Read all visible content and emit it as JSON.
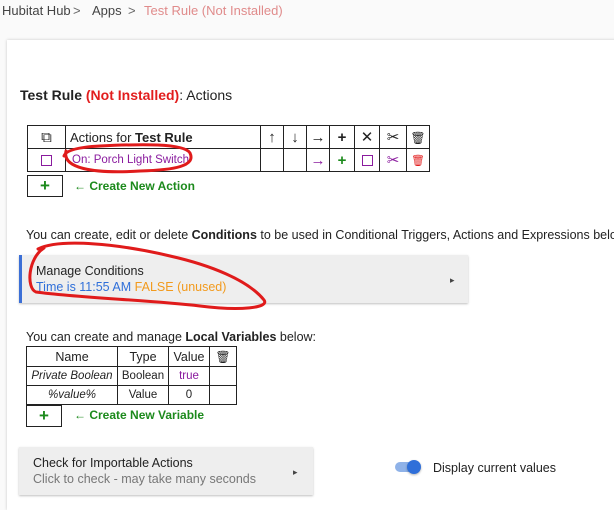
{
  "breadcrumb": {
    "home": "Hubitat Hub",
    "sep": ">",
    "apps": "Apps",
    "current": "Test Rule (Not Installed)"
  },
  "title": {
    "name": "Test Rule",
    "status": "(Not Installed)",
    "suffix": ": Actions"
  },
  "actions_table": {
    "copy_icon": "⧉",
    "header_prefix": "Actions for ",
    "header_rule": "Test Rule",
    "header_icons": [
      "↑",
      "↓",
      "→",
      "+",
      "✕",
      "✂",
      "🗑"
    ],
    "row": {
      "label": "On: Porch Light Switch",
      "arrow": "→",
      "plus": "+",
      "scissors": "✂",
      "trash": "🗑"
    }
  },
  "create_action": {
    "plus": "+",
    "label": "← Create New Action"
  },
  "conditions_desc": {
    "prefix": "You can create, edit or delete ",
    "bold": "Conditions",
    "suffix": " to be used in Conditional Triggers, Actions and Expressions below:"
  },
  "conditions_panel": {
    "title": "Manage Conditions",
    "condition": "Time is 11:55 AM",
    "state": "FALSE",
    "note": "(unused)",
    "arrow": "▸"
  },
  "variables_desc": {
    "prefix": "You can create and manage ",
    "bold": "Local Variables",
    "suffix": " below:"
  },
  "variables_table": {
    "headers": [
      "Name",
      "Type",
      "Value"
    ],
    "trash_icon": "🗑",
    "rows": [
      {
        "name": "Private Boolean",
        "type": "Boolean",
        "value": "true"
      },
      {
        "name": "%value%",
        "type": "Value",
        "value": "0"
      }
    ]
  },
  "create_variable": {
    "plus": "+",
    "label": "← Create New Variable"
  },
  "import_panel": {
    "title": "Check for Importable Actions",
    "subtitle": "Click to check - may take many seconds",
    "arrow": "▸"
  },
  "display_toggle": {
    "label": "Display current values",
    "on": true
  },
  "colors": {
    "accent": "#2f6fd9",
    "not_installed": "#e21d1d",
    "action_text": "#8a1b9e",
    "create_green": "#1c8a1c",
    "false_orange": "#f29a1d",
    "annotation": "#e01b1b"
  }
}
